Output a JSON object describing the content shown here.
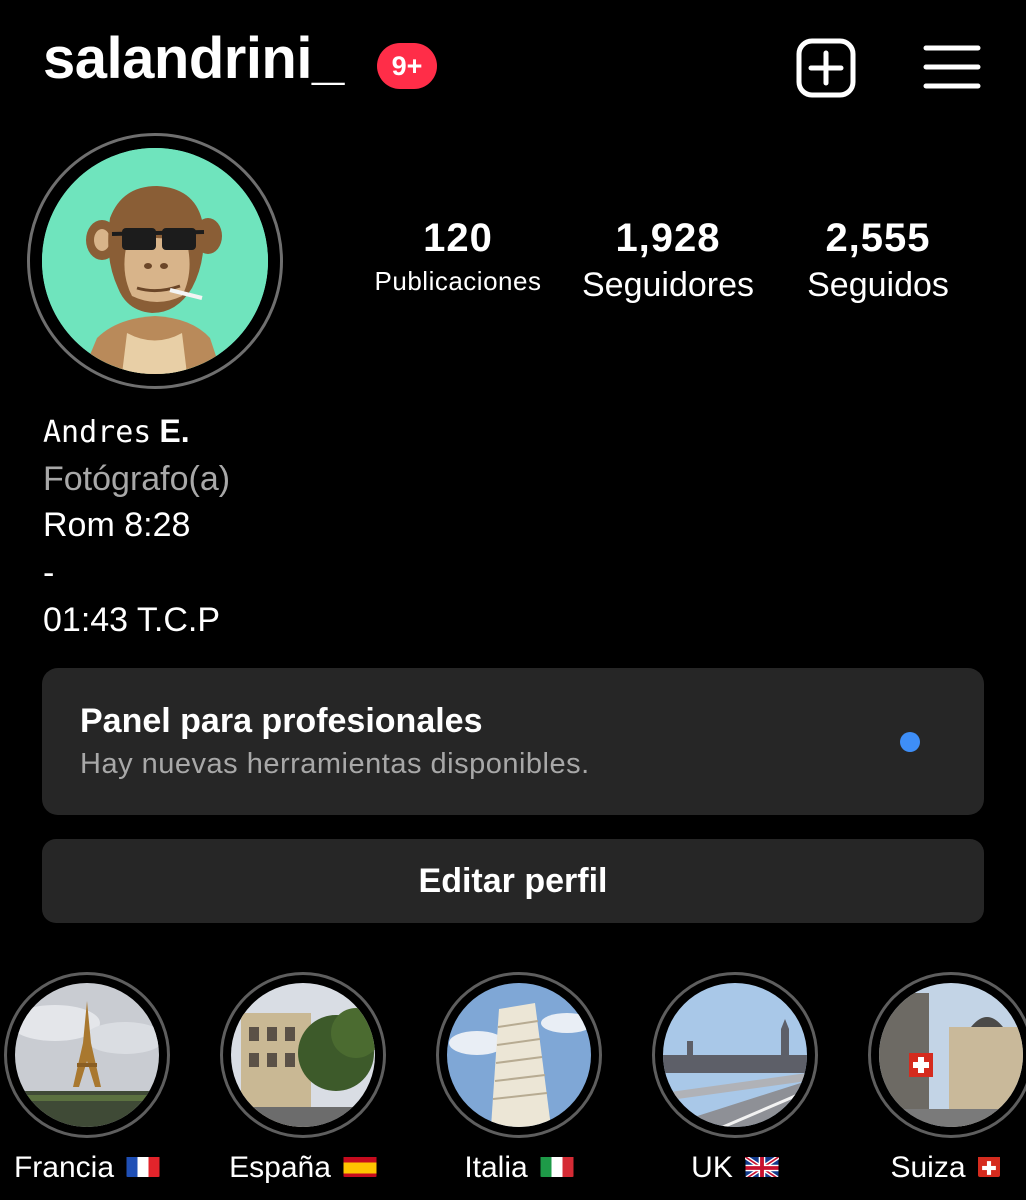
{
  "header": {
    "username": "salandrini_",
    "notification_badge": "9+",
    "new_post_icon": "plus-square-icon",
    "menu_icon": "hamburger-menu-icon"
  },
  "profile": {
    "avatar": "avatar-ape-sunglasses",
    "stats": [
      {
        "value": "120",
        "label": "Publicaciones"
      },
      {
        "value": "1,928",
        "label": "Seguidores"
      },
      {
        "value": "2,555",
        "label": "Seguidos"
      }
    ],
    "name_first": "Andres",
    "name_last": "E.",
    "category": "Fotógrafo(a)",
    "bio_lines": [
      "Rom 8:28",
      "-",
      "01:43 T.C.P"
    ]
  },
  "pro_panel": {
    "title": "Panel para profesionales",
    "subtitle": "Hay nuevas herramientas disponibles.",
    "dot_color": "#3e8ef7"
  },
  "edit_profile_label": "Editar perfil",
  "highlights": [
    {
      "label": "Francia",
      "flag": "flag-france-icon"
    },
    {
      "label": "España",
      "flag": "flag-spain-icon"
    },
    {
      "label": "Italia",
      "flag": "flag-italy-icon"
    },
    {
      "label": "UK",
      "flag": "flag-uk-icon"
    },
    {
      "label": "Suiza",
      "flag": "flag-switzerland-icon"
    }
  ],
  "colors": {
    "background": "#000000",
    "badge": "#ff2d48",
    "card": "#262626",
    "secondary_text": "#a8a8a8",
    "avatar_bg": "#6fe4bd"
  }
}
